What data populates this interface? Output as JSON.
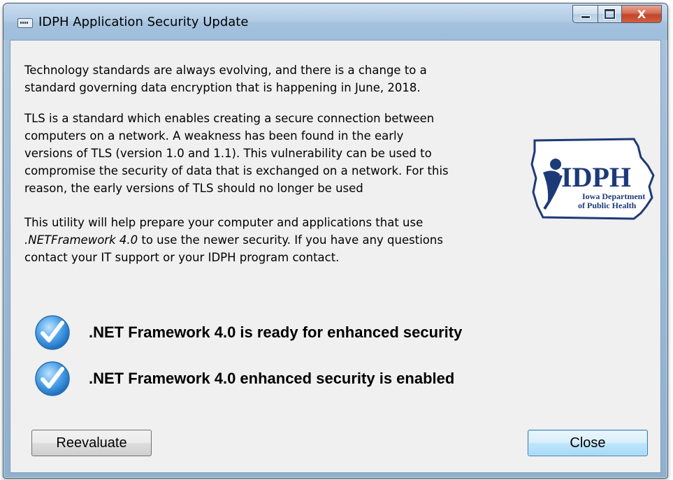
{
  "window": {
    "title": "IDPH Application Security Update",
    "close_glyph": "X"
  },
  "content": {
    "paragraph1": [
      "Technology standards are always evolving, and there is a change to a",
      "standard governing data encryption that is happening in June, 2018."
    ],
    "paragraph2": [
      "TLS is a standard which enables creating a secure connection between",
      "computers on a network. A weakness has been found in the early",
      "versions of TLS (version 1.0 and 1.1). This vulnerability can be used to",
      "compromise the security of data that is exchanged on a network. For this",
      "reason, the early versions of TLS should no longer be used"
    ],
    "paragraph3": {
      "line1": "This utility will help prepare your computer and applications that use",
      "line2_italic": ".NETFramework 4.0",
      "line2_rest": " to use the newer security. If you have any questions",
      "line3": "contact your IT support or your IDPH program contact."
    }
  },
  "logo": {
    "text_main": "IDPH",
    "text_line1": "Iowa Department",
    "text_line2": "of Public Health",
    "color": "#1d3a78"
  },
  "status": [
    {
      "icon": "checkmark-icon",
      "text": ".NET Framework 4.0 is ready for enhanced security"
    },
    {
      "icon": "checkmark-icon",
      "text": ".NET Framework 4.0 enhanced security is enabled"
    }
  ],
  "buttons": {
    "reevaluate": "Reevaluate",
    "close": "Close"
  },
  "colors": {
    "client_bg": "#f0f0f0",
    "check_blue": "#3a8fd9"
  }
}
